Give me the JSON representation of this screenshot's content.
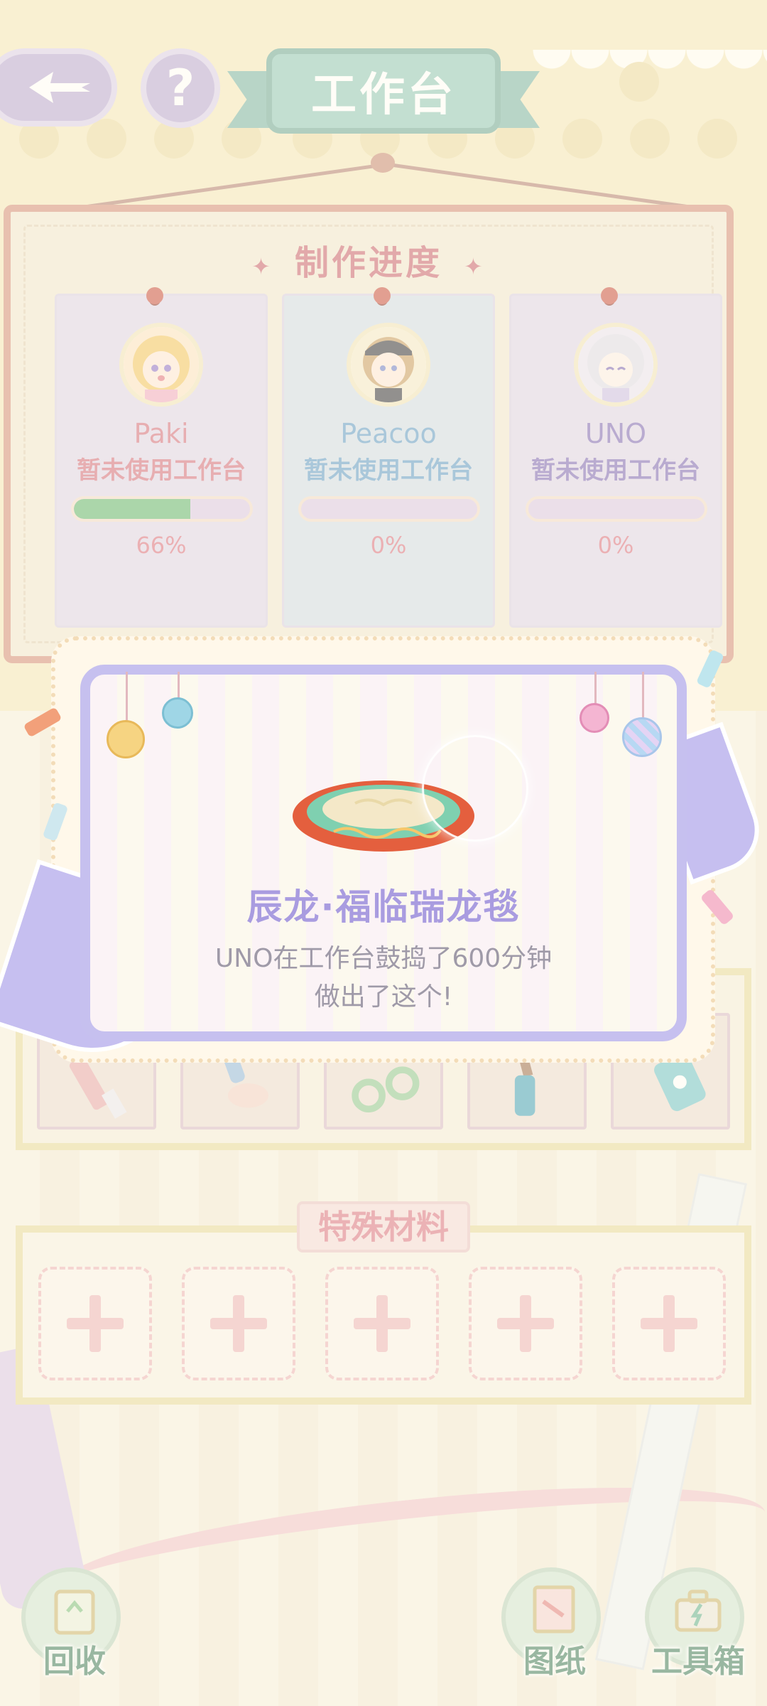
{
  "header": {
    "title": "工作台",
    "help_label": "?"
  },
  "progress_board": {
    "title": "制作进度",
    "players": [
      {
        "name": "Paki",
        "status": "暂未使用工作台",
        "progress": 0.66,
        "progress_text": "66%",
        "name_color": "#d2697a",
        "status_color": "#d2697a",
        "card_bg": "#ddd4e9"
      },
      {
        "name": "Peacoo",
        "status": "暂未使用工作台",
        "progress": 0.0,
        "progress_text": "0%",
        "name_color": "#5a98c8",
        "status_color": "#5a98c8",
        "card_bg": "#cfdbe6"
      },
      {
        "name": "UNO",
        "status": "暂未使用工作台",
        "progress": 0.0,
        "progress_text": "0%",
        "name_color": "#7a63b4",
        "status_color": "#7a63b4",
        "card_bg": "#ddd4e9"
      }
    ]
  },
  "reward_popup": {
    "item_name": "辰龙·福临瑞龙毯",
    "message_line1": "UNO在工作台鼓捣了600分钟",
    "message_line2": "做出了这个!"
  },
  "special_materials": {
    "title": "特殊材料",
    "slot_count": 5
  },
  "bottom_nav": {
    "recycle_label": "回收",
    "blueprint_label": "图纸",
    "toolbox_label": "工具箱"
  },
  "colors": {
    "progress_fill": "#5fb46c",
    "accent_purple": "#c6c0ef",
    "title_teal": "#8cc5b6"
  }
}
